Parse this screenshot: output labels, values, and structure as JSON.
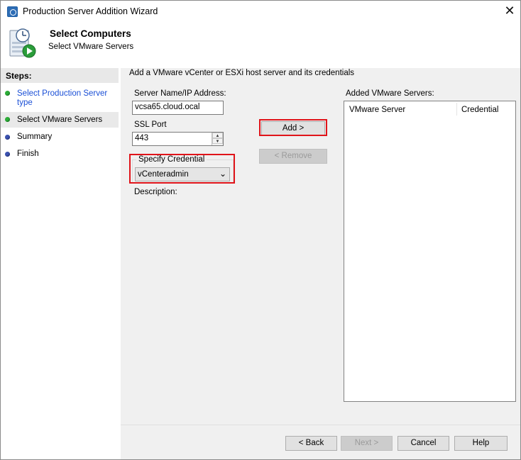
{
  "window": {
    "title": "Production Server Addition Wizard",
    "close_glyph": "✕"
  },
  "header": {
    "title": "Select Computers",
    "subtitle": "Select VMware Servers",
    "icon": "server-clock-play-icon"
  },
  "steps": {
    "heading": "Steps:",
    "items": [
      {
        "label": "Select Production Server type",
        "status_color": "#2cae38",
        "is_link": true
      },
      {
        "label": "Select VMware Servers",
        "status_color": "#2cae38",
        "active": true
      },
      {
        "label": "Summary",
        "status_color": "#3b52b0"
      },
      {
        "label": "Finish",
        "status_color": "#3b52b0"
      }
    ]
  },
  "main": {
    "instruction": "Add a VMware vCenter or ESXi host server and its credentials",
    "server_name_label": "Server Name/IP Address:",
    "server_name_value": "vcsa65.cloud.ocal",
    "ssl_port_label": "SSL Port",
    "ssl_port_value": "443",
    "credential_group_label": "Specify Credential",
    "credential_selected": "vCenteradmin",
    "description_label": "Description:",
    "add_button": "Add >",
    "remove_button": "< Remove",
    "added_servers_label": "Added VMware Servers:",
    "columns": [
      "VMware Server",
      "Credential"
    ],
    "rows": []
  },
  "footer": {
    "back": "< Back",
    "next": "Next >",
    "cancel": "Cancel",
    "help": "Help"
  },
  "colors": {
    "highlight": "#e0141a",
    "link": "#1a4fd6"
  }
}
